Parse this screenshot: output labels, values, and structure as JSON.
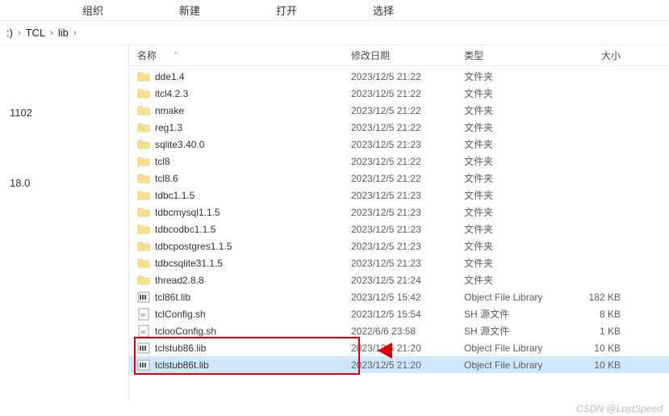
{
  "tabs": {
    "organize": "组织",
    "new": "新建",
    "open": "打开",
    "select": "选择"
  },
  "breadcrumb": {
    "seg0": ":)",
    "seg1": "TCL",
    "seg2": "lib"
  },
  "sidebar": {
    "item0": "1102",
    "item1": "18.0"
  },
  "columns": {
    "name": "名称",
    "date": "修改日期",
    "type": "类型",
    "size": "大小"
  },
  "rows": [
    {
      "icon": "folder",
      "name": "dde1.4",
      "date": "2023/12/5 21:22",
      "type": "文件夹",
      "size": ""
    },
    {
      "icon": "folder",
      "name": "itcl4.2.3",
      "date": "2023/12/5 21:22",
      "type": "文件夹",
      "size": ""
    },
    {
      "icon": "folder",
      "name": "nmake",
      "date": "2023/12/5 21:22",
      "type": "文件夹",
      "size": ""
    },
    {
      "icon": "folder",
      "name": "reg1.3",
      "date": "2023/12/5 21:22",
      "type": "文件夹",
      "size": ""
    },
    {
      "icon": "folder",
      "name": "sqlite3.40.0",
      "date": "2023/12/5 21:23",
      "type": "文件夹",
      "size": ""
    },
    {
      "icon": "folder",
      "name": "tcl8",
      "date": "2023/12/5 21:22",
      "type": "文件夹",
      "size": ""
    },
    {
      "icon": "folder",
      "name": "tcl8.6",
      "date": "2023/12/5 21:22",
      "type": "文件夹",
      "size": ""
    },
    {
      "icon": "folder",
      "name": "tdbc1.1.5",
      "date": "2023/12/5 21:23",
      "type": "文件夹",
      "size": ""
    },
    {
      "icon": "folder",
      "name": "tdbcmysql1.1.5",
      "date": "2023/12/5 21:23",
      "type": "文件夹",
      "size": ""
    },
    {
      "icon": "folder",
      "name": "tdbcodbc1.1.5",
      "date": "2023/12/5 21:23",
      "type": "文件夹",
      "size": ""
    },
    {
      "icon": "folder",
      "name": "tdbcpostgres1.1.5",
      "date": "2023/12/5 21:23",
      "type": "文件夹",
      "size": ""
    },
    {
      "icon": "folder",
      "name": "tdbcsqlite31.1.5",
      "date": "2023/12/5 21:23",
      "type": "文件夹",
      "size": ""
    },
    {
      "icon": "folder",
      "name": "thread2.8.8",
      "date": "2023/12/5 21:24",
      "type": "文件夹",
      "size": ""
    },
    {
      "icon": "lib",
      "name": "tcl86t.lib",
      "date": "2023/12/5 15:42",
      "type": "Object File Library",
      "size": "182 KB"
    },
    {
      "icon": "sh",
      "name": "tclConfig.sh",
      "date": "2023/12/5 15:54",
      "type": "SH 源文件",
      "size": "8 KB"
    },
    {
      "icon": "sh",
      "name": "tclooConfig.sh",
      "date": "2022/6/6 23:58",
      "type": "SH 源文件",
      "size": "1 KB"
    },
    {
      "icon": "lib",
      "name": "tclstub86.lib",
      "date": "2023/12/5 21:20",
      "type": "Object File Library",
      "size": "10 KB"
    },
    {
      "icon": "lib",
      "name": "tclstub86t.lib",
      "date": "2023/12/5 21:20",
      "type": "Object File Library",
      "size": "10 KB",
      "selected": true
    }
  ],
  "watermark": "CSDN @LostSpeed"
}
